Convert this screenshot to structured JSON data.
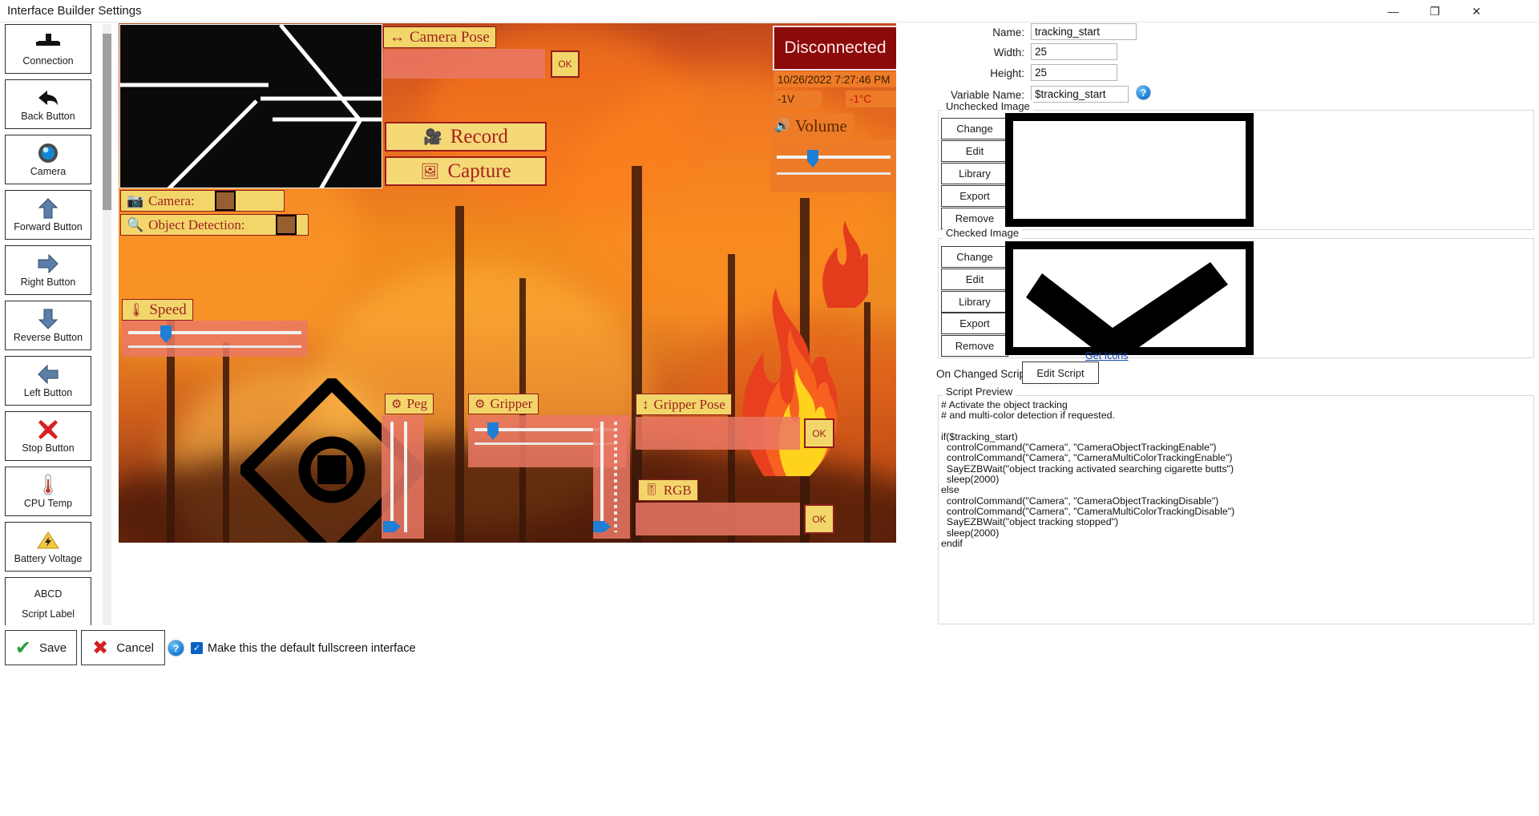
{
  "window": {
    "title": "Interface Builder Settings",
    "minimize": "—",
    "maximize": "❐",
    "close": "✕"
  },
  "palette": {
    "items": [
      {
        "label": "Connection",
        "icon": "connection-icon"
      },
      {
        "label": "Back Button",
        "icon": "back-arrow-icon"
      },
      {
        "label": "Camera",
        "icon": "camera-lens-icon"
      },
      {
        "label": "Forward Button",
        "icon": "up-arrow-icon"
      },
      {
        "label": "Right Button",
        "icon": "right-arrow-icon"
      },
      {
        "label": "Reverse Button",
        "icon": "down-arrow-icon"
      },
      {
        "label": "Left Button",
        "icon": "left-arrow-icon"
      },
      {
        "label": "Stop Button",
        "icon": "red-x-icon"
      },
      {
        "label": "CPU Temp",
        "icon": "thermometer-icon"
      },
      {
        "label": "Battery Voltage",
        "icon": "battery-warning-icon"
      },
      {
        "label": "ABCD",
        "label2": "Script Label",
        "icon": "text-icon"
      }
    ]
  },
  "canvas": {
    "camera_pose": {
      "label": "Camera Pose",
      "icon": "left-right-arrow-icon",
      "ok": "OK"
    },
    "record": {
      "label": "Record",
      "icon": "video-camera-icon"
    },
    "capture": {
      "label": "Capture",
      "icon": "photo-icon"
    },
    "camera_toggle": {
      "label": "Camera:",
      "icon": "camera-icon"
    },
    "object_detection": {
      "label": "Object Detection:",
      "icon": "magnifier-icon"
    },
    "speed": {
      "label": "Speed",
      "icon": "speedometer-icon"
    },
    "peg": {
      "label": "Peg",
      "icon": "gear-icon"
    },
    "gripper": {
      "label": "Gripper",
      "icon": "gear-icon"
    },
    "gripper_pose": {
      "label": "Gripper Pose",
      "icon": "up-down-arrow-icon",
      "ok": "OK"
    },
    "rgb": {
      "label": "RGB",
      "icon": "rgb-icon",
      "ok": "OK"
    },
    "volume": {
      "label": "Volume",
      "icon": "speaker-icon"
    },
    "status": {
      "connection": "Disconnected",
      "datetime": "10/26/2022 7:27:46 PM",
      "voltage": "-1V",
      "temperature": "-1°C"
    },
    "colors": {
      "label_bg": "#f2d66a",
      "label_border": "#8f1d1d",
      "label_text": "#9e1f1f",
      "panel_bg": "#ea7864",
      "disconnected_bg": "#8b0a0a",
      "chip_bg": "#ee7b28",
      "slider_knob": "#1e7fd4"
    }
  },
  "properties": {
    "name_label": "Name:",
    "name_value": "tracking_start",
    "width_label": "Width:",
    "width_value": "25",
    "height_label": "Height:",
    "height_value": "25",
    "variable_label": "Variable Name:",
    "variable_value": "$tracking_start",
    "unchecked_group": "Unchecked Image",
    "checked_group": "Checked Image",
    "image_buttons": [
      "Change",
      "Edit",
      "Library",
      "Export",
      "Remove"
    ],
    "get_icons_link": "Get Icons",
    "on_changed_label": "On Changed Script:",
    "edit_script_button": "Edit Script",
    "script_preview_title": "Script Preview",
    "script_preview_text": "# Activate the object tracking\n# and multi-color detection if requested.\n\nif($tracking_start)\n  controlCommand(\"Camera\", \"CameraObjectTrackingEnable\")\n  controlCommand(\"Camera\", \"CameraMultiColorTrackingEnable\")\n  SayEZBWait(\"object tracking activated searching cigarette butts\")\n  sleep(2000)\nelse\n  controlCommand(\"Camera\", \"CameraObjectTrackingDisable\")\n  controlCommand(\"Camera\", \"CameraMultiColorTrackingDisable\")\n  SayEZBWait(\"object tracking stopped\")\n  sleep(2000)\nendif",
    "help_icon": "help-icon"
  },
  "bottom": {
    "save": "Save",
    "cancel": "Cancel",
    "help_icon": "help-icon",
    "default_fullscreen_label": "Make this the default fullscreen interface",
    "default_fullscreen_checked": true
  }
}
